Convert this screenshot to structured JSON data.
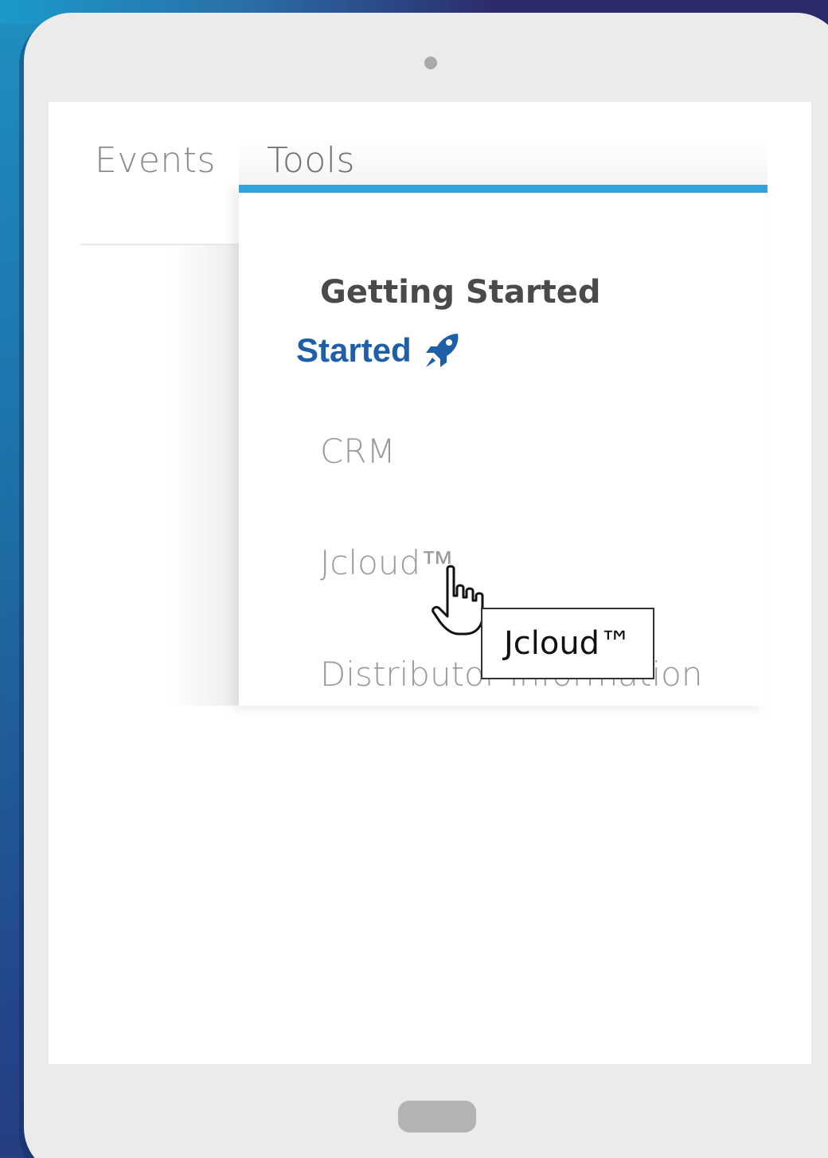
{
  "nav": {
    "tabs": [
      {
        "label": "Events"
      },
      {
        "label": "Tools"
      }
    ]
  },
  "dropdown": {
    "heading": "Getting Started",
    "started_label": "Started",
    "started_icon": "rocket-icon",
    "items": [
      {
        "label": "CRM"
      },
      {
        "label": "Jcloud™"
      },
      {
        "label": "Distributor Information"
      }
    ]
  },
  "tooltip": {
    "text": "Jcloud™"
  },
  "colors": {
    "accent": "#2ea3dc",
    "link": "#1f5fa8",
    "background_start": "#1f8fc0",
    "background_end": "#2a2f6e"
  }
}
